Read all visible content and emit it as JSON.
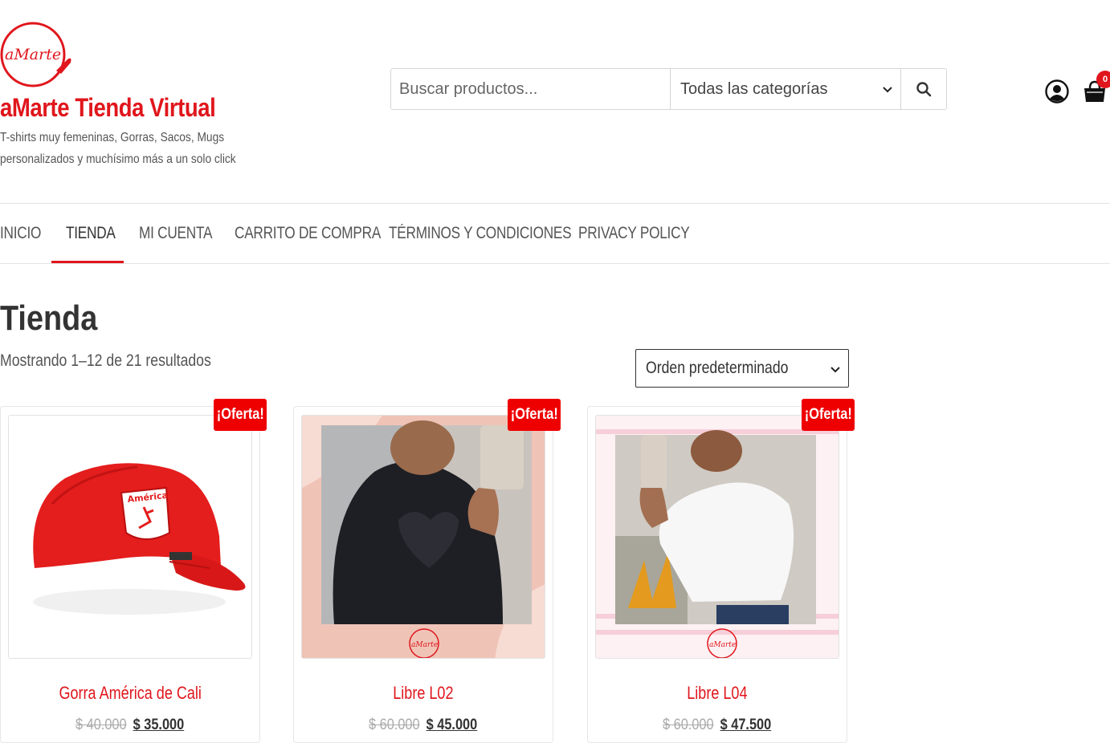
{
  "header": {
    "logo_text": "aMarte",
    "site_title": "aMarte Tienda Virtual",
    "tagline": "T-shirts muy femeninas, Gorras, Sacos, Mugs personalizados y muchísimo más a un solo click"
  },
  "search": {
    "placeholder": "Buscar productos...",
    "category_selected": "Todas las categorías",
    "search_icon": "search-icon"
  },
  "user": {
    "account_icon": "account-icon",
    "cart_icon": "shopping-bag-icon",
    "cart_count": "0"
  },
  "nav": {
    "items": [
      {
        "label": "INICIO"
      },
      {
        "label": "TIENDA"
      },
      {
        "label": "MI CUENTA"
      },
      {
        "label": "CARRITO DE COMPRA"
      },
      {
        "label": "TÉRMINOS Y CONDICIONES"
      },
      {
        "label": "PRIVACY POLICY"
      }
    ],
    "active": "TIENDA"
  },
  "shop": {
    "title": "Tienda",
    "result_count": "Mostrando 1–12 de 21 resultados",
    "ordering_selected": "Orden predeterminado"
  },
  "products": [
    {
      "name": "Gorra América de Cali",
      "old_price": "$ 40.000",
      "price": "$ 35.000",
      "badge": "¡Oferta!"
    },
    {
      "name": "Libre L02",
      "old_price": "$ 60.000",
      "price": "$ 45.000",
      "badge": "¡Oferta!"
    },
    {
      "name": "Libre L04",
      "old_price": "$ 60.000",
      "price": "$ 47.500",
      "badge": "¡Oferta!"
    }
  ],
  "colors": {
    "brand_red": "#e0161c",
    "badge_red": "#ee0000"
  }
}
